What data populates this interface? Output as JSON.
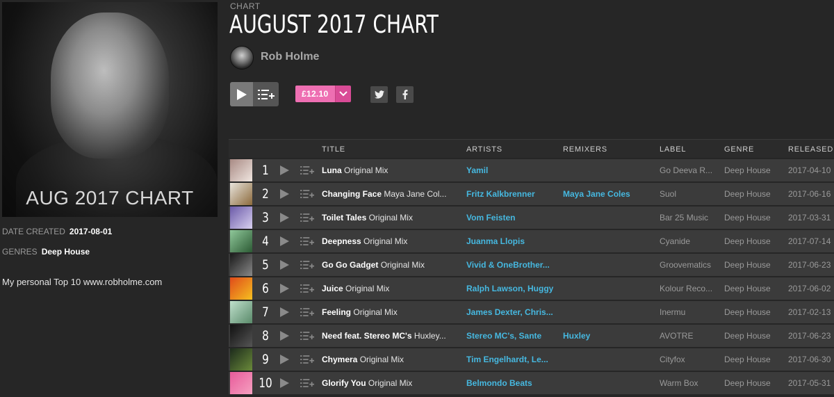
{
  "cover": {
    "text": "AUG  2017 CHART"
  },
  "meta": {
    "date_label": "DATE CREATED",
    "date_value": "2017-08-01",
    "genres_label": "GENRES",
    "genres_value": "Deep House",
    "description": "My personal Top 10 www.robholme.com"
  },
  "header": {
    "eyebrow": "CHART",
    "title": "AUGUST 2017 CHART",
    "artist": "Rob Holme",
    "price": "£12.10"
  },
  "controls": {
    "play_icon": "play-icon",
    "queue_icon": "add-to-queue-icon",
    "twitter_icon": "twitter-icon",
    "facebook_icon": "facebook-icon"
  },
  "columns": {
    "title": "TITLE",
    "artists": "ARTISTS",
    "remixers": "REMIXERS",
    "label": "LABEL",
    "genre": "GENRE",
    "released": "RELEASED"
  },
  "colors": {
    "background": "#262626",
    "row": "#3b3b3b",
    "link": "#46b8e0",
    "price": "#ee6fb2"
  },
  "tracks": [
    {
      "num": "1",
      "name": "Luna",
      "mix": "Original Mix",
      "artists": "Yamil",
      "remixers": "",
      "label": "Go Deeva R...",
      "genre": "Deep House",
      "released": "2017-04-10",
      "art": [
        "#a88a84",
        "#f0e6e0"
      ]
    },
    {
      "num": "2",
      "name": "Changing Face",
      "mix": "Maya Jane Col...",
      "artists": "Fritz Kalkbrenner",
      "remixers": "Maya Jane Coles",
      "label": "Suol",
      "genre": "Deep House",
      "released": "2017-06-16",
      "art": [
        "#e8e4dc",
        "#8c6a3c"
      ]
    },
    {
      "num": "3",
      "name": "Toilet Tales",
      "mix": "Original Mix",
      "artists": "Vom Feisten",
      "remixers": "",
      "label": "Bar 25 Music",
      "genre": "Deep House",
      "released": "2017-03-31",
      "art": [
        "#6b5aa8",
        "#d8d0f0"
      ]
    },
    {
      "num": "4",
      "name": "Deepness",
      "mix": "Original Mix",
      "artists": "Juanma Llopis",
      "remixers": "",
      "label": "Cyanide",
      "genre": "Deep House",
      "released": "2017-07-14",
      "art": [
        "#8fc89a",
        "#2c5a34"
      ]
    },
    {
      "num": "5",
      "name": "Go Go Gadget",
      "mix": "Original Mix",
      "artists": "Vivid & OneBrother...",
      "remixers": "",
      "label": "Groovematics",
      "genre": "Deep House",
      "released": "2017-06-23",
      "art": [
        "#1a1a1a",
        "#888888"
      ]
    },
    {
      "num": "6",
      "name": "Juice",
      "mix": "Original Mix",
      "artists": "Ralph Lawson, Huggy",
      "remixers": "",
      "label": "Kolour Reco...",
      "genre": "Deep House",
      "released": "2017-06-02",
      "art": [
        "#e04a1a",
        "#f5c020"
      ]
    },
    {
      "num": "7",
      "name": "Feeling",
      "mix": "Original Mix",
      "artists": "James Dexter, Chris...",
      "remixers": "",
      "label": "Inermu",
      "genre": "Deep House",
      "released": "2017-02-13",
      "art": [
        "#bfe0cc",
        "#5a8a6a"
      ]
    },
    {
      "num": "8",
      "name": "Need feat. Stereo MC's",
      "mix": "Huxley...",
      "artists": "Stereo MC's, Sante",
      "remixers": "Huxley",
      "label": "AVOTRE",
      "genre": "Deep House",
      "released": "2017-06-23",
      "art": [
        "#111111",
        "#555555"
      ]
    },
    {
      "num": "9",
      "name": "Chymera",
      "mix": "Original Mix",
      "artists": "Tim Engelhardt, Le...",
      "remixers": "",
      "label": "Cityfox",
      "genre": "Deep House",
      "released": "2017-06-30",
      "art": [
        "#1c2a1c",
        "#6a8a3a"
      ]
    },
    {
      "num": "10",
      "name": "Glorify You",
      "mix": "Original Mix",
      "artists": "Belmondo Beats",
      "remixers": "",
      "label": "Warm Box",
      "genre": "Deep House",
      "released": "2017-05-31",
      "art": [
        "#e85a9a",
        "#f5a0c0"
      ]
    }
  ]
}
